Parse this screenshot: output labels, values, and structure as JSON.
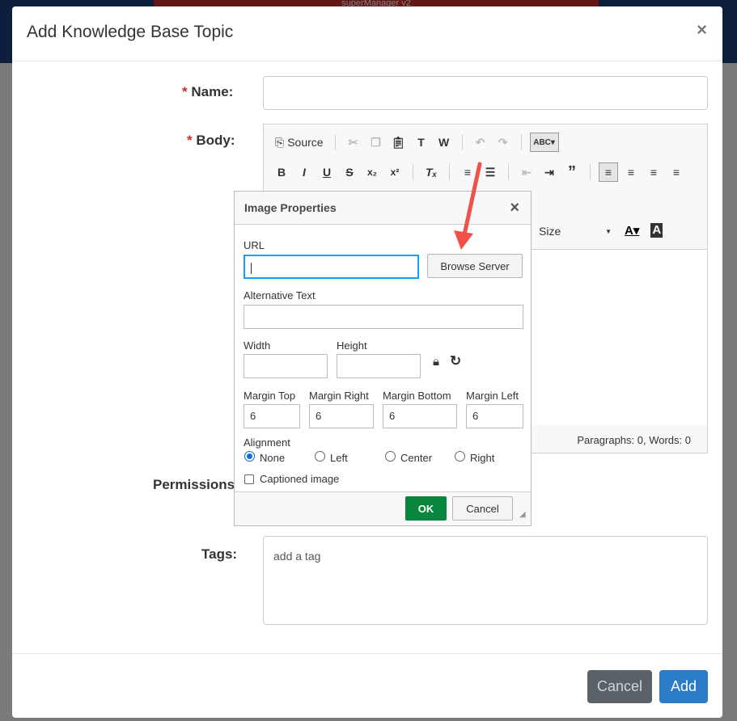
{
  "background": {
    "top_tab_label": "superManager v2"
  },
  "modal": {
    "title": "Add Knowledge Base Topic",
    "close_glyph": "×",
    "name_label": "Name:",
    "body_label": "Body:",
    "required_mark": "*",
    "permissions_label": "Permissions:",
    "tags_label": "Tags:",
    "tags_placeholder": "add a tag",
    "cancel_label": "Cancel",
    "add_label": "Add"
  },
  "editor": {
    "source_label": "Source",
    "size_label": "Size",
    "status_text": "Paragraphs: 0, Words: 0"
  },
  "image_dialog": {
    "title": "Image Properties",
    "close_glyph": "×",
    "url_label": "URL",
    "url_value": "",
    "browse_label": "Browse Server",
    "alt_label": "Alternative Text",
    "alt_value": "",
    "width_label": "Width",
    "width_value": "",
    "height_label": "Height",
    "height_value": "",
    "margin_top_label": "Margin Top",
    "margin_top_value": "6",
    "margin_right_label": "Margin Right",
    "margin_right_value": "6",
    "margin_bottom_label": "Margin Bottom",
    "margin_bottom_value": "6",
    "margin_left_label": "Margin Left",
    "margin_left_value": "6",
    "alignment_label": "Alignment",
    "align_none": "None",
    "align_left": "Left",
    "align_center": "Center",
    "align_right": "Right",
    "align_selected": "None",
    "captioned_label": "Captioned image",
    "ok_label": "OK",
    "cancel_label": "Cancel"
  },
  "colors": {
    "ok_green": "#09863e",
    "add_blue": "#2a7cc7",
    "annotation_arrow": "#f0524a"
  }
}
